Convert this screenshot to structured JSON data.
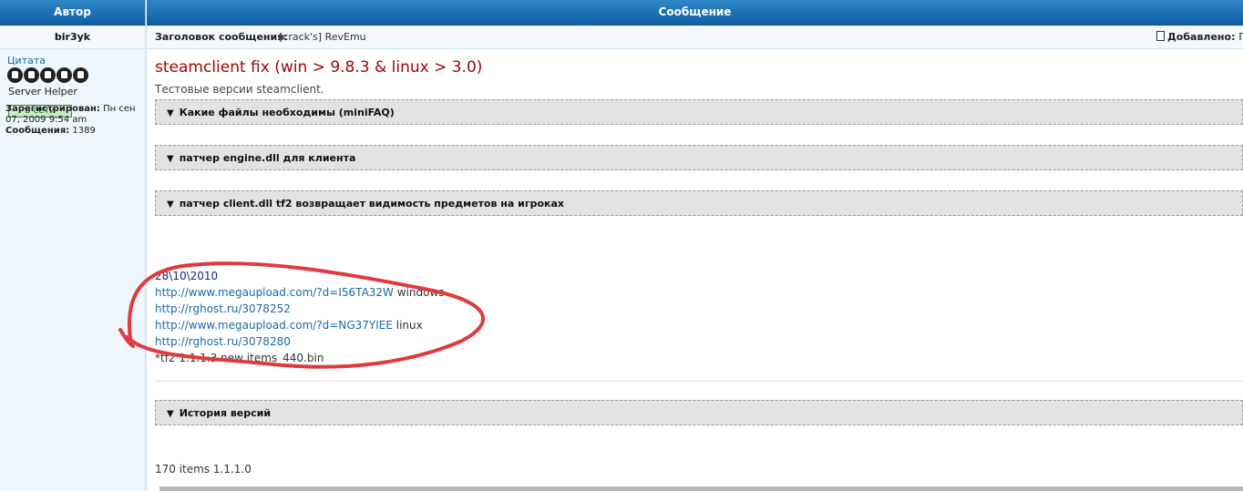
{
  "header": {
    "author_col": "Автор",
    "message_col": "Сообщение"
  },
  "author": {
    "name": "bir3yk",
    "rank_link": "Цитата",
    "rank_title": "Server Helper",
    "online_status": "в сети",
    "registered_label": "Зарегистрирован:",
    "registered_value": "Пн сен 07, 2009 9:54 am",
    "posts_label": "Сообщения:",
    "posts_value": "1389"
  },
  "subject": {
    "label": "Заголовок сообщения:",
    "value": "[crack's] RevEmu",
    "posted_label": "Добавлено:",
    "posted_value": "П"
  },
  "post": {
    "title": "steamclient fix (win > 9.8.3 & linux > 3.0)",
    "subtitle": "Тестовые версии steamclient.",
    "spoilers": [
      "Какие файлы необходимы (miniFAQ)",
      "патчер engine.dll для клиента",
      "патчер client.dll tf2 возвращает видимость предметов на игроках"
    ],
    "date": "28\\10\\2010",
    "links": [
      {
        "url": "http://www.megaupload.com/?d=I56TA32W",
        "note": "windows"
      },
      {
        "url": "http://rghost.ru/3078252",
        "note": ""
      },
      {
        "url": "http://www.megaupload.com/?d=NG37YIEE",
        "note": "linux"
      },
      {
        "url": "http://rghost.ru/3078280",
        "note": ""
      }
    ],
    "extra_note": "*tf2 1.1.1.3 new items_440.bin",
    "history_spoiler": "История версий",
    "footer": "170 items 1.1.1.0"
  },
  "colors": {
    "header_bg": "#0d5fa5",
    "title_red": "#a0050a",
    "link_blue": "#1a69a8",
    "circle_red": "#e03a3e"
  }
}
